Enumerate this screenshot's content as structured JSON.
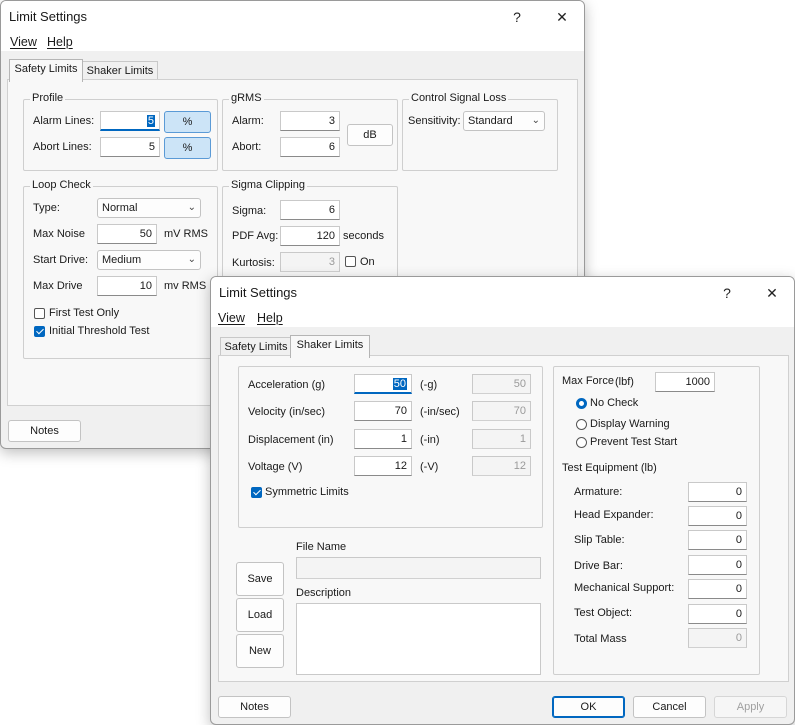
{
  "win1": {
    "title": "Limit Settings",
    "help_btn": "?",
    "close_btn": "✕",
    "menu": [
      "View",
      "Help"
    ],
    "tabs": [
      "Safety Limits",
      "Shaker Limits"
    ],
    "profile": {
      "label": "Profile",
      "alarm_label": "Alarm Lines:",
      "alarm_value": "5",
      "abort_label": "Abort Lines:",
      "abort_value": "5",
      "pct": "%"
    },
    "grms": {
      "label": "gRMS",
      "alarm_label": "Alarm:",
      "alarm_value": "3",
      "abort_label": "Abort:",
      "abort_value": "6",
      "db": "dB"
    },
    "csl": {
      "label": "Control Signal Loss",
      "sens_label": "Sensitivity:",
      "sens_value": "Standard"
    },
    "loop": {
      "label": "Loop Check",
      "type_label": "Type:",
      "type_value": "Normal",
      "noise_label": "Max Noise",
      "noise_value": "50",
      "noise_unit": "mV RMS",
      "start_label": "Start Drive:",
      "start_value": "Medium",
      "drive_label": "Max Drive",
      "drive_value": "10",
      "drive_unit": "mv RMS",
      "first_test": "First Test Only",
      "initial_threshold": "Initial Threshold Test"
    },
    "sigma": {
      "label": "Sigma Clipping",
      "sigma_label": "Sigma:",
      "sigma_value": "6",
      "pdf_label": "PDF Avg:",
      "pdf_value": "120",
      "pdf_unit": "seconds",
      "kurt_label": "Kurtosis:",
      "kurt_value": "3",
      "on_label": "On"
    },
    "notes": "Notes"
  },
  "win2": {
    "title": "Limit Settings",
    "help_btn": "?",
    "close_btn": "✕",
    "menu": [
      "View",
      "Help"
    ],
    "tabs": [
      "Safety Limits",
      "Shaker Limits"
    ],
    "limits": [
      {
        "label": "Acceleration (g)",
        "value": "50",
        "neg_label": "(-g)",
        "neg_value": "50"
      },
      {
        "label": "Velocity (in/sec)",
        "value": "70",
        "neg_label": "(-in/sec)",
        "neg_value": "70"
      },
      {
        "label": "Displacement (in)",
        "value": "1",
        "neg_label": "(-in)",
        "neg_value": "1"
      },
      {
        "label": "Voltage (V)",
        "value": "12",
        "neg_label": "(-V)",
        "neg_value": "12"
      }
    ],
    "symmetric": "Symmetric Limits",
    "file_name_label": "File Name",
    "description_label": "Description",
    "save": "Save",
    "load": "Load",
    "new": "New",
    "max_force_label": "Max Force",
    "max_force_unit": "(lbf)",
    "max_force_value": "1000",
    "radios": [
      "No Check",
      "Display Warning",
      "Prevent Test Start"
    ],
    "test_equipment_label": "Test Equipment (lb)",
    "equipment": [
      {
        "label": "Armature:",
        "value": "0"
      },
      {
        "label": "Head Expander:",
        "value": "0"
      },
      {
        "label": "Slip Table:",
        "value": "0"
      },
      {
        "label": "Drive Bar:",
        "value": "0"
      },
      {
        "label": "Mechanical Support:",
        "value": "0"
      },
      {
        "label": "Test Object:",
        "value": "0"
      }
    ],
    "total_mass_label": "Total Mass",
    "total_mass_value": "0",
    "notes": "Notes",
    "ok": "OK",
    "cancel": "Cancel",
    "apply": "Apply"
  }
}
